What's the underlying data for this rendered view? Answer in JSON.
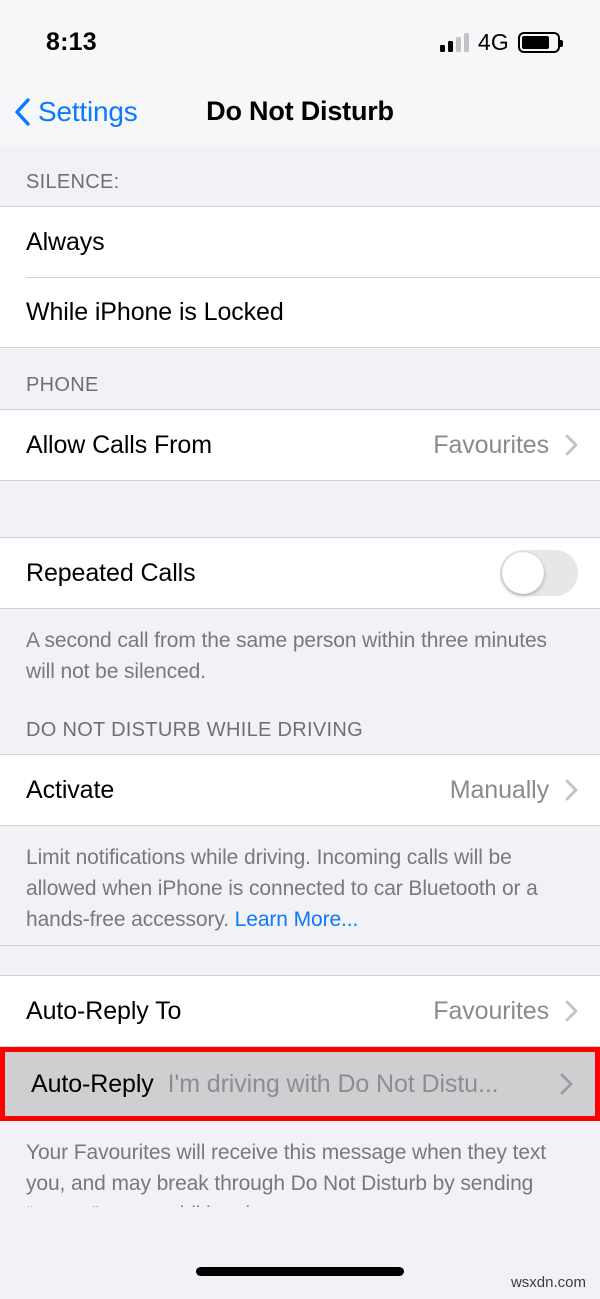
{
  "status_bar": {
    "time": "8:13",
    "network": "4G",
    "signal_icon": "signal-bars-icon",
    "battery_icon": "battery-icon"
  },
  "nav": {
    "back_label": "Settings",
    "back_icon": "chevron-left-icon",
    "title": "Do Not Disturb"
  },
  "sections": {
    "silence": {
      "header": "SILENCE:",
      "rows": [
        {
          "label": "Always"
        },
        {
          "label": "While iPhone is Locked"
        }
      ]
    },
    "phone": {
      "header": "PHONE",
      "allow_calls": {
        "label": "Allow Calls From",
        "value": "Favourites",
        "chevron_icon": "chevron-right-icon"
      }
    },
    "repeated_calls": {
      "label": "Repeated Calls",
      "toggle_state": "off",
      "toggle_icon": "toggle-switch",
      "footer": "A second call from the same person within three minutes will not be silenced."
    },
    "driving": {
      "header": "DO NOT DISTURB WHILE DRIVING",
      "activate": {
        "label": "Activate",
        "value": "Manually",
        "chevron_icon": "chevron-right-icon"
      },
      "footer_text": "Limit notifications while driving. Incoming calls will be allowed when iPhone is connected to car Bluetooth or a hands-free accessory. ",
      "footer_link": "Learn More..."
    },
    "auto_reply": {
      "to_row": {
        "label": "Auto-Reply To",
        "value": "Favourites",
        "chevron_icon": "chevron-right-icon"
      },
      "message_row": {
        "label": "Auto-Reply",
        "value": "I'm driving with Do Not Distu...",
        "chevron_icon": "chevron-right-icon",
        "state": "pressed-highlighted"
      },
      "footer": "Your Favourites will receive this message when they text you, and may break through Do Not Disturb by sending “urgent” as an additional message."
    }
  },
  "watermark": "wsxdn.com",
  "colors": {
    "accent_blue": "#0a7aff",
    "highlight_red": "#ff0000",
    "group_bg": "#f2f1f6",
    "row_bg": "#ffffff",
    "pressed_bg": "#cfcfd2",
    "secondary_text": "#8a8a8f"
  }
}
